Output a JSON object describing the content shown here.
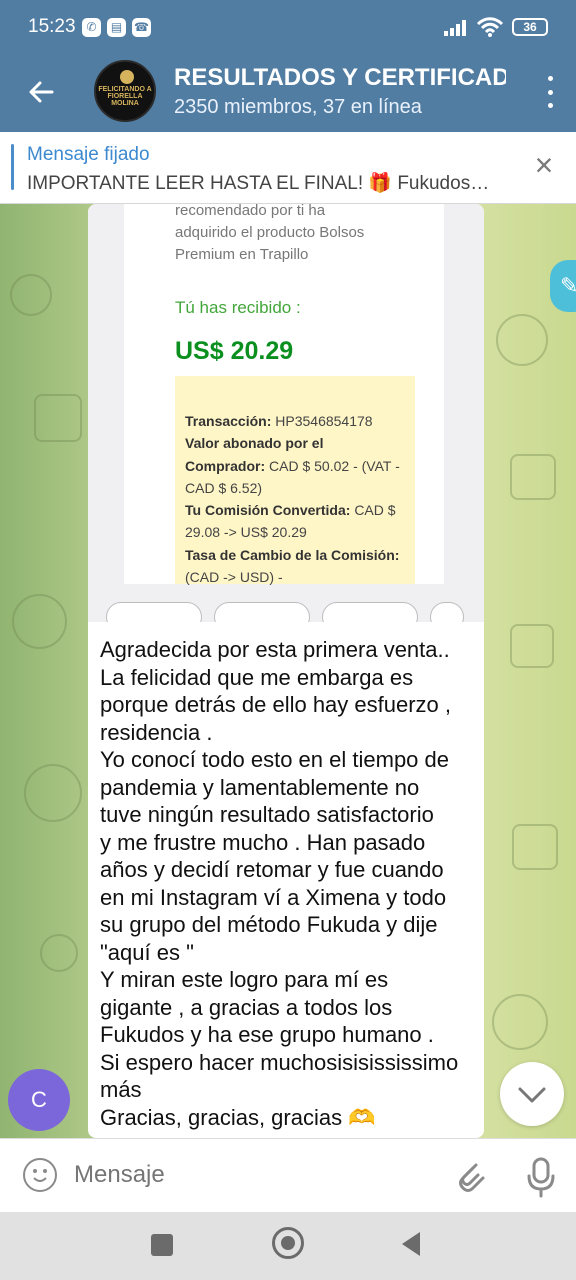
{
  "status_bar": {
    "time": "15:23",
    "battery": "36",
    "icons": [
      "whatsapp-icon",
      "message-app-icon",
      "phone-app-icon",
      "signal-icon",
      "wifi-icon",
      "battery-icon"
    ]
  },
  "chat_header": {
    "title": "RESULTADOS Y CERTIFICAD",
    "subtitle": "2350 miembros, 37 en línea",
    "avatar_text": "FELICITANDO A\nFIORELLA MOLINA"
  },
  "pinned": {
    "label": "Mensaje fijado",
    "text": "IMPORTANTE LEER HASTA EL FINAL! 🎁  Fukudos…",
    "close": "×"
  },
  "message": {
    "image_receipt": {
      "intro_text": "recomendado por ti ha\nadquirido el producto Bolsos\nPremium en Trapillo",
      "received_label": "Tú has recibido :",
      "amount": "US$ 20.29",
      "details": [
        {
          "label": "Transacción:",
          "value": "HP3546854178"
        },
        {
          "label": "Valor abonado por el Comprador:",
          "value": "CAD $ 50.02 - (VAT - CAD $ 6.52)"
        },
        {
          "label": "Tu Comisión Convertida:",
          "value": "CAD $ 29.08 -> US$ 20.29"
        },
        {
          "label": "Tasa de Cambio de la Comisión:",
          "value": "(CAD -> USD) -"
        }
      ]
    },
    "text": "Agradecida por esta primera venta..\nLa felicidad que me embarga es\nporque detrás de ello hay esfuerzo ,\nresidencia .\nYo conocí todo esto en el tiempo de\npandemia y lamentablemente no\ntuve ningún resultado satisfactorio\ny me frustre mucho . Han pasado\naños y decidí retomar y fue cuando\nen mi Instagram ví a Ximena y todo\nsu grupo del método Fukuda y dije\n\"aquí es \"\nY miran este logro para mí es\ngigante , a gracias a todos los\nFukudos y ha ese grupo humano .\nSi espero hacer muchosisisississimo\nmás\nGracias, gracias, gracias 🫶"
  },
  "sender_avatar": "C",
  "composer": {
    "placeholder": "Mensaje"
  },
  "colors": {
    "header": "#527da3",
    "link": "#3c89cf",
    "success": "#0b8f1f",
    "avatar": "#7c67da"
  }
}
